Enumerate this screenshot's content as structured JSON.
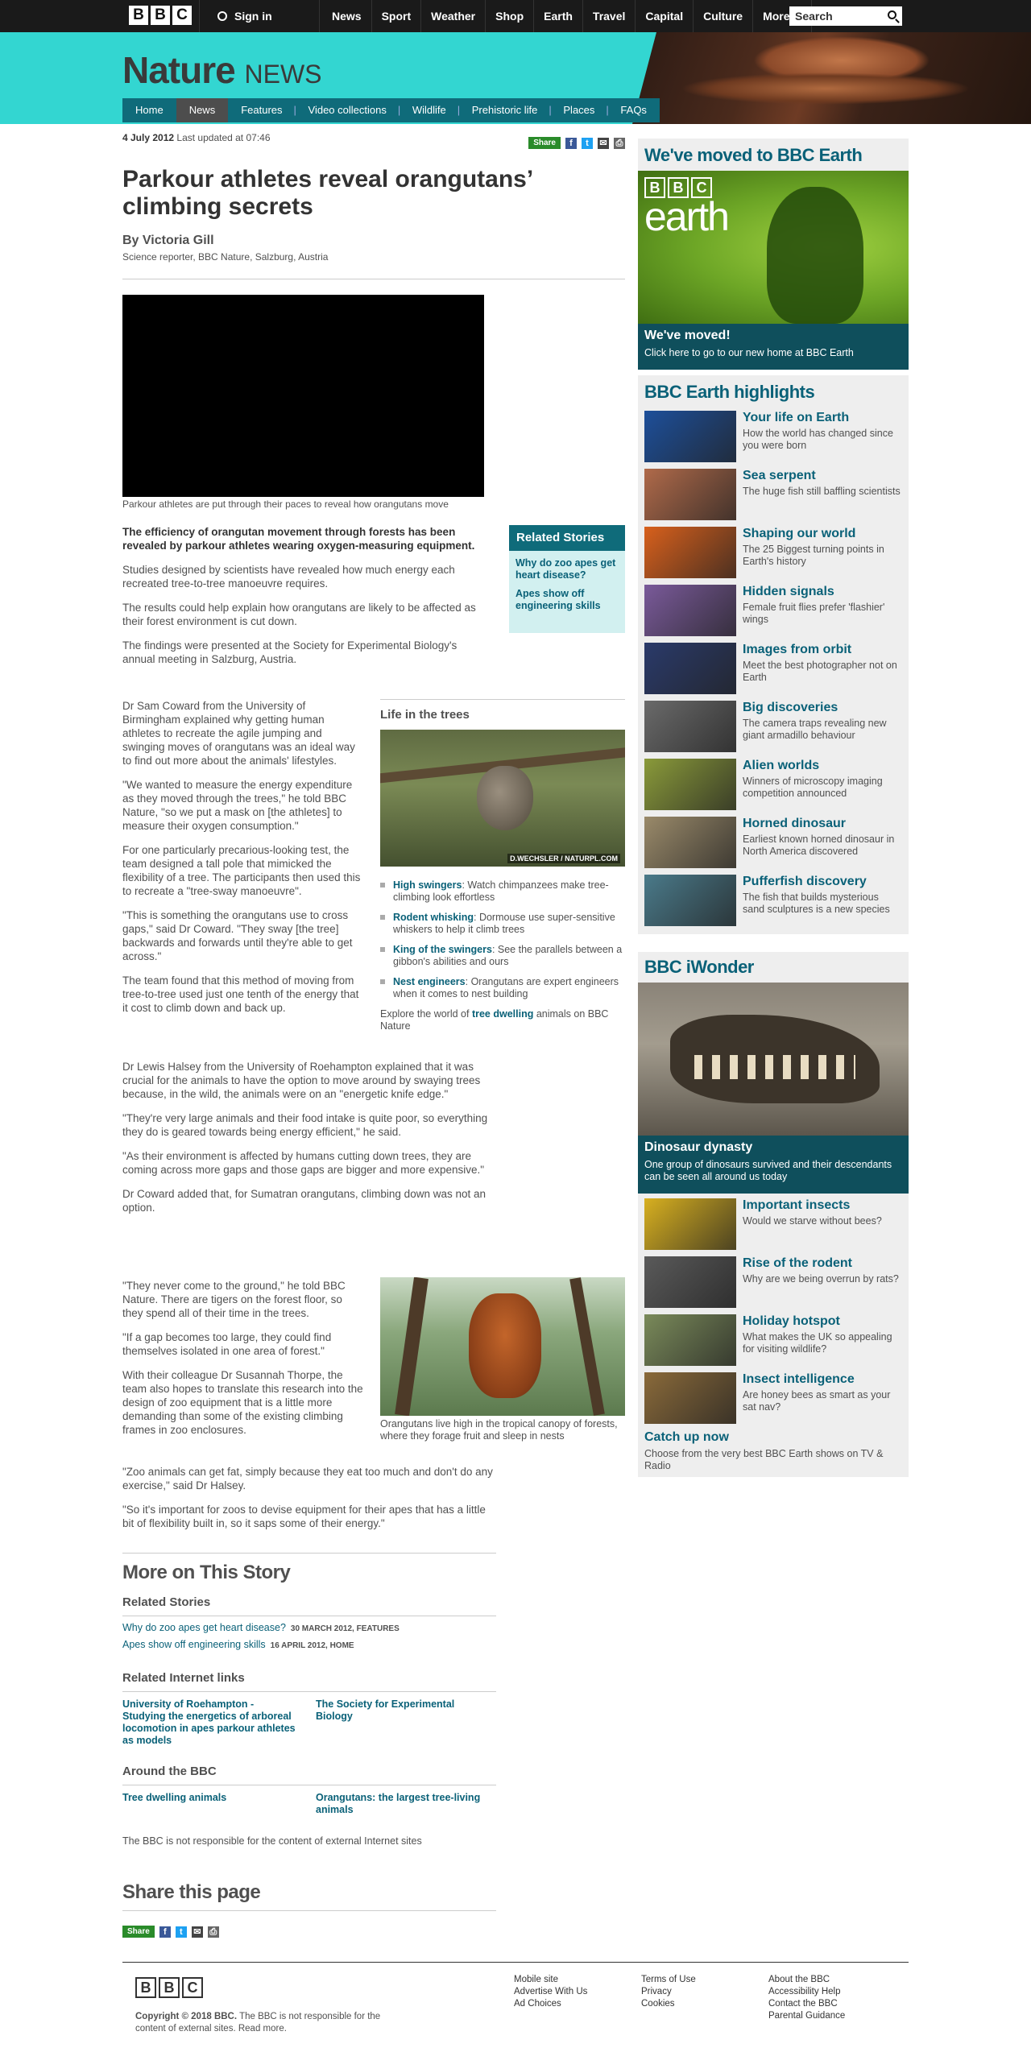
{
  "top": {
    "signin": "Sign in",
    "nav": [
      "News",
      "Sport",
      "Weather",
      "Shop",
      "Earth",
      "Travel",
      "Capital",
      "Culture",
      "More…"
    ],
    "search_placeholder": "Search"
  },
  "masthead": {
    "logo_main": "Nature",
    "logo_sub": "NEWS"
  },
  "secnav": [
    "Home",
    "News",
    "Features",
    "Video collections",
    "Wildlife",
    "Prehistoric life",
    "Places",
    "FAQs"
  ],
  "article": {
    "date": "4 July 2012",
    "updated": "Last updated at 07:46",
    "share": "Share",
    "title": "Parkour athletes reveal orangutans’ climbing secrets",
    "author": "By Victoria Gill",
    "role": "Science reporter, BBC Nature, Salzburg, Austria",
    "video_caption": "Parkour athletes are put through their paces to reveal how orangutans move",
    "intro": "The efficiency of orangutan movement through forests has been revealed by parkour athletes wearing oxygen-measuring equipment.",
    "p1": "Studies designed by scientists have revealed how much energy each recreated tree-to-tree manoeuvre requires.",
    "p2": "The results could help explain how orangutans are likely to be affected as their forest environment is cut down.",
    "p3": "The findings were presented at the Society for Experimental Biology's annual meeting in Salzburg, Austria.",
    "p4": "Dr Sam Coward from the University of Birmingham explained why getting human athletes to recreate the agile jumping and swinging moves of orangutans was an ideal way to find out more about the animals' lifestyles.",
    "p5": "\"We wanted to measure the energy expenditure as they moved through the trees,\" he told BBC Nature, \"so we put a mask on [the athletes] to measure their oxygen consumption.\"",
    "p6": "For one particularly precarious-looking test, the team designed a tall pole that mimicked the flexibility of a tree. The participants then used this to recreate a \"tree-sway manoeuvre\".",
    "p7": "\"This is something the orangutans use to cross gaps,\" said Dr Coward. \"They sway [the tree] backwards and forwards until they're able to get across.\"",
    "p8": "The team found that this method of moving from tree-to-tree used just one tenth of the energy that it cost to climb down and back up.",
    "p9": "Dr Lewis Halsey from the University of Roehampton explained that it was crucial for the animals to have the option to move around by swaying trees because, in the wild, the animals were on an \"energetic knife edge.\"",
    "p10": "\"They're very large animals and their food intake is quite poor, so everything they do is geared towards being energy efficient,\" he said.",
    "p11": "\"As their environment is affected by humans cutting down trees, they are coming across more gaps and those gaps are bigger and more expensive.\"",
    "p12": "Dr Coward added that, for Sumatran orangutans, climbing down was not an option.",
    "p13": "\"They never come to the ground,\" he told BBC Nature. There are tigers on the forest floor, so they spend all of their time in the trees.",
    "p14": "\"If a gap becomes too large, they could find themselves isolated in one area of forest.\"",
    "p15": "With their colleague Dr Susannah Thorpe, the team also hopes to translate this research into the design of zoo equipment that is a little more demanding than some of the existing climbing frames in zoo enclosures.",
    "p16": "\"Zoo animals can get fat, simply because they eat too much and don't do any exercise,\" said Dr Halsey.",
    "p17": "\"So it's important for zoos to devise equipment for their apes that has a little bit of flexibility built in, so it saps some of their energy.\""
  },
  "related_box": {
    "heading": "Related Stories",
    "links": [
      "Why do zoo apes get heart disease?",
      "Apes show off engineering skills"
    ]
  },
  "trees": {
    "heading": "Life in the trees",
    "credit": "D.WECHSLER / NATURPL.COM",
    "items": [
      {
        "title": "High swingers",
        "text": ": Watch chimpanzees make tree-climbing look effortless"
      },
      {
        "title": "Rodent whisking",
        "text": ": Dormouse use super-sensitive whiskers to help it climb trees"
      },
      {
        "title": "King of the swingers",
        "text": ": See the parallels between a gibbon's abilities and ours"
      },
      {
        "title": "Nest engineers",
        "text": ": Orangutans are expert engineers when it comes to nest building"
      }
    ],
    "explore_pre": "Explore the world of ",
    "explore_link": "tree dwelling",
    "explore_post": " animals on BBC Nature"
  },
  "orang_caption": "Orangutans live high in the tropical canopy of forests, where they forage fruit and sleep in nests",
  "more": {
    "heading": "More on This Story",
    "related_heading": "Related Stories",
    "related": [
      {
        "title": "Why do zoo apes get heart disease?",
        "meta": "30 MARCH 2012, FEATURES"
      },
      {
        "title": "Apes show off engineering skills",
        "meta": "16 APRIL 2012, HOME"
      }
    ],
    "internet_heading": "Related Internet links",
    "internet": [
      "University of Roehampton - Studying the energetics of arboreal locomotion in apes parkour athletes as models",
      "The Society for Experimental Biology"
    ],
    "around_heading": "Around the BBC",
    "around": [
      "Tree dwelling animals",
      "Orangutans: the largest tree-living animals"
    ],
    "disclaimer": "The BBC is not responsible for the content of external Internet sites",
    "share_heading": "Share this page",
    "share": "Share"
  },
  "sidebar": {
    "moved_heading": "We've moved to BBC Earth",
    "earth_word": "earth",
    "moved_title": "We've moved!",
    "moved_text": "Click here to go to our new home at BBC Earth",
    "highlights_heading": "BBC Earth highlights",
    "highlights": [
      {
        "title": "Your life on Earth",
        "text": "How the world has changed since you were born",
        "color": "#1d4f9a"
      },
      {
        "title": "Sea serpent",
        "text": "The huge fish still baffling scientists",
        "color": "#b06a4a"
      },
      {
        "title": "Shaping our world",
        "text": "The 25 Biggest turning points in Earth's history",
        "color": "#d8601c"
      },
      {
        "title": "Hidden signals",
        "text": "Female fruit flies prefer 'flashier' wings",
        "color": "#7a5a9a"
      },
      {
        "title": "Images from orbit",
        "text": "Meet the best photographer not on Earth",
        "color": "#2a3a6a"
      },
      {
        "title": "Big discoveries",
        "text": "The camera traps revealing new giant armadillo behaviour",
        "color": "#6a6a6a"
      },
      {
        "title": "Alien worlds",
        "text": "Winners of microscopy imaging competition announced",
        "color": "#8a9a3a"
      },
      {
        "title": "Horned dinosaur",
        "text": "Earliest known horned dinosaur in North America discovered",
        "color": "#9a8a6a"
      },
      {
        "title": "Pufferfish discovery",
        "text": "The fish that builds mysterious sand sculptures is a new species",
        "color": "#4a7a8a"
      }
    ],
    "iwonder_heading": "BBC iWonder",
    "dino_title": "Dinosaur dynasty",
    "dino_text": "One group of dinosaurs survived and their descendants can be seen all around us today",
    "iwonder_items": [
      {
        "title": "Important insects",
        "text": "Would we starve without bees?",
        "color": "#d8b020"
      },
      {
        "title": "Rise of the rodent",
        "text": "Why are we being overrun by rats?",
        "color": "#5a5a5a"
      },
      {
        "title": "Holiday hotspot",
        "text": "What makes the UK so appealing for visiting wildlife?",
        "color": "#7a8a5a"
      },
      {
        "title": "Insect intelligence",
        "text": "Are honey bees as smart as your sat nav?",
        "color": "#8a6a3a"
      }
    ],
    "catchup_title": "Catch up now",
    "catchup_text": "Choose from the very best BBC Earth shows on TV & Radio"
  },
  "footer": {
    "copyright": "Copyright © 2018 BBC.",
    "copy_text": "The BBC is not responsible for the content of external sites. Read more.",
    "col1": [
      "Mobile site",
      "Advertise With Us",
      "Ad Choices"
    ],
    "col2": [
      "Terms of Use",
      "Privacy",
      "Cookies"
    ],
    "col3": [
      "About the BBC",
      "Accessibility Help",
      "Contact the BBC",
      "Parental Guidance"
    ]
  }
}
